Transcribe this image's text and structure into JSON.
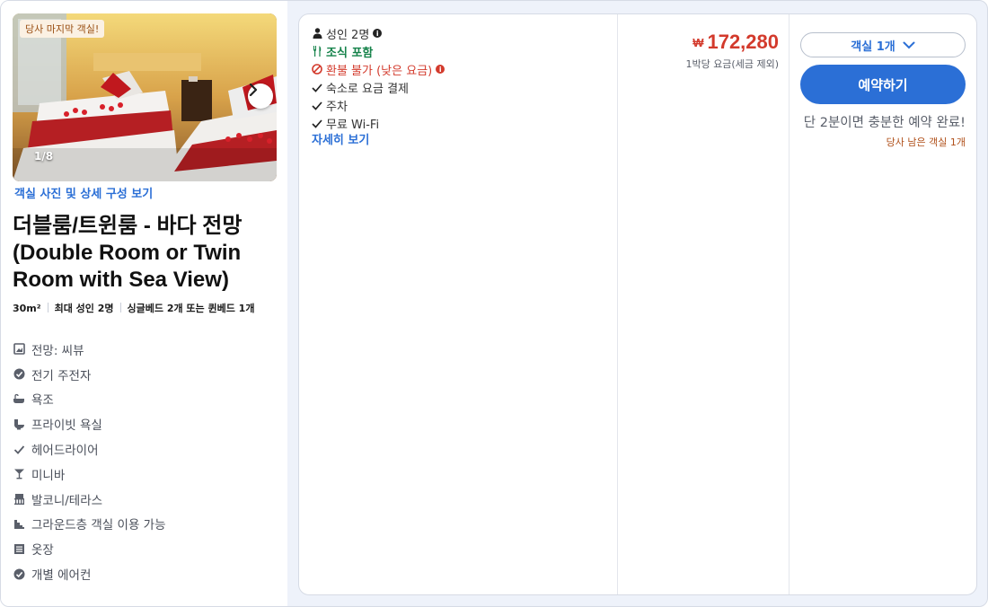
{
  "room": {
    "badge": "당사 마지막 객실!",
    "photo_counter": "1/8",
    "photo_link": "객실 사진 및 상세 구성 보기",
    "title": "더블룸/트윈룸 - 바다 전망 (Double Room or Twin Room with Sea View)",
    "specs": [
      "30m²",
      "최대 성인 2명",
      "싱글베드 2개 또는 퀸베드 1개"
    ],
    "amenities": [
      {
        "icon": "view-icon",
        "label": "전망: 씨뷰"
      },
      {
        "icon": "kettle-icon",
        "label": "전기 주전자"
      },
      {
        "icon": "bathtub-icon",
        "label": "욕조"
      },
      {
        "icon": "toilet-icon",
        "label": "프라이빗 욕실"
      },
      {
        "icon": "check-icon",
        "label": "헤어드라이어"
      },
      {
        "icon": "cocktail-icon",
        "label": "미니바"
      },
      {
        "icon": "balcony-icon",
        "label": "발코니/테라스"
      },
      {
        "icon": "stairs-icon",
        "label": "그라운드층 객실 이용 가능"
      },
      {
        "icon": "wardrobe-icon",
        "label": "옷장"
      },
      {
        "icon": "aircon-icon",
        "label": "개별 에어컨"
      }
    ]
  },
  "offer": {
    "benefits": [
      {
        "icon": "person-icon",
        "label": "성인 2명",
        "info": true
      },
      {
        "icon": "utensils-icon",
        "label": "조식 포함"
      },
      {
        "icon": "no-refund-icon",
        "label": "환불 불가 (낮은 요금)",
        "info": true
      },
      {
        "icon": "check-icon",
        "label": "숙소로 요금 결제"
      },
      {
        "icon": "check-icon",
        "label": "주차"
      },
      {
        "icon": "check-icon",
        "label": "무료 Wi-Fi"
      }
    ],
    "more_link": "자세히 보기",
    "currency": "₩",
    "price": "172,280",
    "price_note": "1박당 요금(세금 제외)",
    "room_select": "객실 1개",
    "book_label": "예약하기",
    "fast_note": "단 2분이면 충분한 예약 완료!",
    "last_note": "당사 남은 객실 1개"
  },
  "colors": {
    "accent": "#2b6fd6",
    "price": "#d33a2c",
    "green": "#15824a",
    "warning": "#b0501a"
  }
}
